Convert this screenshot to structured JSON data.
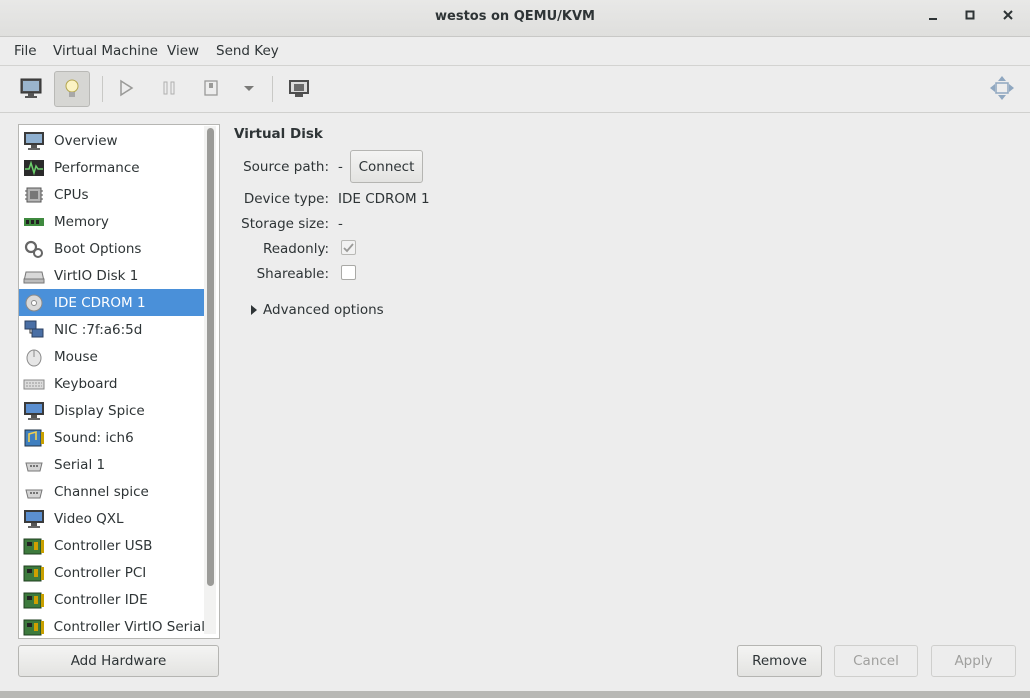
{
  "window": {
    "title": "westos on QEMU/KVM",
    "minimize": "_",
    "maximize": "▫",
    "close": "×"
  },
  "menu": [
    "File",
    "Virtual Machine",
    "View",
    "Send Key"
  ],
  "sidebar": {
    "items": [
      {
        "label": "Overview",
        "icon": "monitor-icon"
      },
      {
        "label": "Performance",
        "icon": "performance-graph-icon"
      },
      {
        "label": "CPUs",
        "icon": "cpu-chip-icon"
      },
      {
        "label": "Memory",
        "icon": "memory-stick-icon"
      },
      {
        "label": "Boot Options",
        "icon": "gears-icon"
      },
      {
        "label": "VirtIO Disk 1",
        "icon": "hard-disk-icon"
      },
      {
        "label": "IDE CDROM 1",
        "icon": "cdrom-icon",
        "selected": true
      },
      {
        "label": "NIC :7f:a6:5d",
        "icon": "network-icon"
      },
      {
        "label": "Mouse",
        "icon": "mouse-icon"
      },
      {
        "label": "Keyboard",
        "icon": "keyboard-icon"
      },
      {
        "label": "Display Spice",
        "icon": "display-icon"
      },
      {
        "label": "Sound: ich6",
        "icon": "sound-card-icon"
      },
      {
        "label": "Serial 1",
        "icon": "serial-port-icon"
      },
      {
        "label": "Channel spice",
        "icon": "channel-icon"
      },
      {
        "label": "Video QXL",
        "icon": "video-card-icon"
      },
      {
        "label": "Controller USB",
        "icon": "controller-card-icon"
      },
      {
        "label": "Controller PCI",
        "icon": "controller-card-icon"
      },
      {
        "label": "Controller IDE",
        "icon": "controller-card-icon"
      },
      {
        "label": "Controller VirtIO Serial",
        "icon": "controller-card-icon"
      }
    ],
    "add_hardware": "Add Hardware"
  },
  "details": {
    "heading": "Virtual Disk",
    "source_path_label": "Source path:",
    "source_path_value": "-",
    "connect_button": "Connect",
    "device_type_label": "Device type:",
    "device_type_value": "IDE CDROM 1",
    "storage_size_label": "Storage size:",
    "storage_size_value": "-",
    "readonly_label": "Readonly:",
    "readonly_checked": true,
    "shareable_label": "Shareable:",
    "shareable_checked": false,
    "advanced_label": "Advanced options"
  },
  "footer": {
    "remove": "Remove",
    "cancel": "Cancel",
    "apply": "Apply"
  },
  "colors": {
    "selection": "#4a90d9",
    "window_bg": "#ededed"
  }
}
